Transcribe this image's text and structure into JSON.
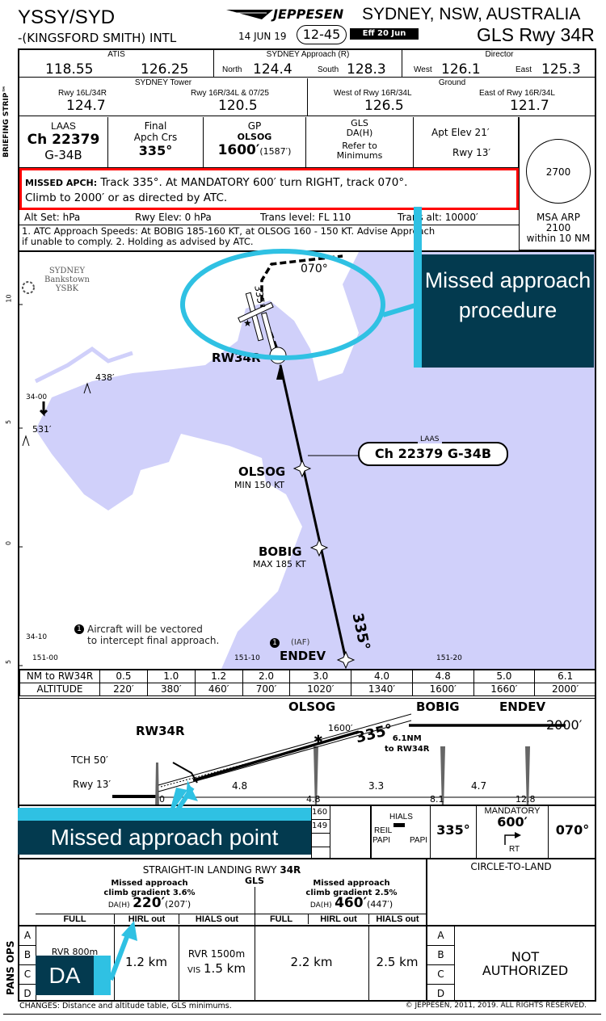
{
  "header": {
    "ident": "YSSY/SYD",
    "airport": "-(KINGSFORD SMITH) INTL",
    "brand": "JEPPESEN",
    "city": "SYDNEY, NSW, AUSTRALIA",
    "date": "14 JUN 19",
    "chart_no": "12-45",
    "effective": "Eff 20 Jun",
    "procedure": "GLS Rwy 34R"
  },
  "briefing_label": "BRIEFING STRIP™",
  "comms": {
    "atis": {
      "label": "ATIS",
      "f1": "118.55",
      "f2": "126.25"
    },
    "approach": {
      "label": "SYDNEY Approach (R)",
      "l1": "North",
      "f1": "124.4",
      "l2": "South",
      "f2": "128.3"
    },
    "director": {
      "label": "Director",
      "l1": "West",
      "f1": "126.1",
      "l2": "East",
      "f2": "125.3"
    },
    "tower": {
      "label": "SYDNEY Tower",
      "l1": "Rwy 16L/34R",
      "f1": "124.7",
      "l2": "Rwy 16R/34L & 07/25",
      "f2": "120.5"
    },
    "ground": {
      "label": "Ground",
      "l1": "West of Rwy 16R/34L",
      "f1": "126.5",
      "l2": "East of Rwy 16R/34L",
      "f2": "121.7"
    }
  },
  "info": {
    "laas": {
      "label": "LAAS",
      "ch": "Ch 22379",
      "id": "G-34B"
    },
    "crs": {
      "l1": "Final",
      "l2": "Apch Crs",
      "v": "335°"
    },
    "gp": {
      "label": "GP",
      "fix": "OLSOG",
      "alt": "1600′",
      "h": "(1587′)"
    },
    "gls": {
      "l1": "GLS",
      "l2": "DA(H)",
      "l3": "Refer to",
      "l4": "Minimums"
    },
    "elev": {
      "apt": "Apt Elev 21′",
      "rwy": "Rwy 13′"
    },
    "msa": {
      "alt": "2700",
      "l1": "MSA ARP",
      "l2": "2100",
      "l3": "within 10 NM"
    }
  },
  "missed": {
    "label": "MISSED APCH:",
    "text1": "Track 335°. At MANDATORY 600′ turn RIGHT, track 070°.",
    "text2": "Climb to 2000′ or as directed by ATC."
  },
  "altset": {
    "a": "Alt Set: hPa",
    "b": "Rwy Elev: 0 hPa",
    "c": "Trans level: FL 110",
    "d": "Trans alt: 10000′"
  },
  "notes": {
    "l1": "1. ATC Approach Speeds: At BOBIG 185-160 KT, at OLSOG 160 - 150 KT. Advise Approach",
    "l2": "if unable to comply. 2. Holding as advised by ATC."
  },
  "map": {
    "colors": {
      "water": "#d0d0fa",
      "land": "#ffffff"
    },
    "bankstown": {
      "l1": "SYDNEY",
      "l2": "Bankstown",
      "l3": "YSBK"
    },
    "rwy": "RW34R",
    "olsog": "OLSOG",
    "olsog_spd": "MIN 150 KT",
    "bobig": "BOBIG",
    "bobig_spd": "MAX 185 KT",
    "endev": "ENDEV",
    "iaf": "(IAF)",
    "ma_crs1": "335°",
    "ma_crs2": "070°",
    "final_crs": "335°",
    "laas_box_label": "LAAS",
    "laas_box": "Ch 22379 G-34B",
    "obst1": "438′",
    "obst2": "531′",
    "lat1": "34-00",
    "lat2": "34-10",
    "lon1": "151-00",
    "lon2": "151-10",
    "lon3": "151-20",
    "scale": [
      "10",
      "5",
      "0",
      "5"
    ],
    "note": "Aircraft will be vectored",
    "note2": "to intercept final approach.",
    "note_num": "1"
  },
  "dist_table": {
    "row1_label": "NM to RW34R",
    "nm": [
      "0.5",
      "1.0",
      "1.2",
      "2.0",
      "3.0",
      "4.0",
      "4.8",
      "5.0",
      "6.1"
    ],
    "row2_label": "ALTITUDE",
    "alt": [
      "220′",
      "380′",
      "460′",
      "700′",
      "1020′",
      "1340′",
      "1600′",
      "1660′",
      "2000′"
    ]
  },
  "profile": {
    "rwy": "RW34R",
    "olsog": "OLSOG",
    "bobig": "BOBIG",
    "endev": "ENDEV",
    "gp_alt": "1600′",
    "crs": "335°",
    "to_rwy1": "6.1NM",
    "to_rwy2": "to RW34R",
    "alt": "2000′",
    "tch": "TCH 50′",
    "rwy_elev": "Rwy 13′",
    "seg": [
      "4.8",
      "3.3",
      "4.7"
    ],
    "dist": [
      "0",
      "4.8",
      "8.1",
      "12.8"
    ]
  },
  "strip": {
    "v1": "160",
    "v2": "149",
    "hials": "HIALS",
    "reil": "REIL",
    "papi1": "PAPI",
    "papi2": "PAPI",
    "crs": "335°",
    "mand": "MANDATORY",
    "mand_alt": "600′",
    "rt": "RT",
    "trk": "070°"
  },
  "minimums": {
    "title": "STRAIGHT-IN LANDING RWY",
    "rwy": "34R",
    "gls": "GLS",
    "left": {
      "g1": "Missed approach",
      "g2": "climb gradient 3.6%",
      "da": "DA(H)",
      "alt": "220′",
      "h": "(207′)"
    },
    "right": {
      "g1": "Missed approach",
      "g2": "climb gradient 2.5%",
      "da": "DA(H)",
      "alt": "460′",
      "h": "(447′)"
    },
    "cols": [
      "FULL",
      "HIRL out",
      "HIALS out",
      "FULL",
      "HIRL out",
      "HIALS out"
    ],
    "vals": {
      "full": "RVR 800m",
      "hirl": "1.2 km",
      "hials_rvr": "RVR 1500m",
      "hials_vis_l": "VIS",
      "hials_vis": "1.5 km",
      "full2": "2.2 km",
      "hirl2": "2.5 km"
    },
    "cats": [
      "A",
      "B",
      "C",
      "D"
    ],
    "pans": "PANS OPS",
    "ctl": "CIRCLE-TO-LAND",
    "na1": "NOT",
    "na2": "AUTHORIZED"
  },
  "footer": {
    "changes": "CHANGES: Distance and altitude table, GLS minimums.",
    "copyright": "© JEPPESEN, 2011, 2019. ALL RIGHTS RESERVED."
  },
  "callouts": {
    "map": "Missed approach procedure",
    "mapt": "Missed approach point",
    "da": "DA",
    "colors": {
      "box": "#033a4f",
      "accent": "#2fc1e3",
      "highlight": "#ff0000"
    }
  }
}
